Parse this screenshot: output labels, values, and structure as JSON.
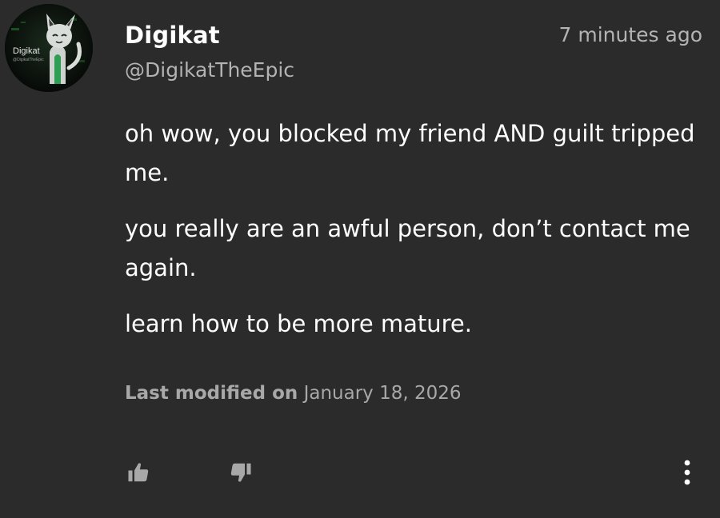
{
  "comment": {
    "author": {
      "display_name": "Digikat",
      "handle": "@DigikatTheEpic",
      "avatar_caption": "Digikat",
      "avatar_subcaption": "@DigikatTheEpic"
    },
    "timestamp": "7 minutes ago",
    "paragraphs": [
      "oh wow, you blocked my friend AND guilt tripped me.",
      "you really are an awful person, don’t contact me again.",
      "learn how to be more mature."
    ],
    "modified_label": "Last modified on",
    "modified_date": "January 18, 2026"
  },
  "actions": {
    "like_icon": "thumbs-up-icon",
    "dislike_icon": "thumbs-down-icon",
    "more_icon": "more-vertical-icon"
  },
  "colors": {
    "background": "#2b2b2b",
    "text_primary": "#ffffff",
    "text_secondary": "#b3b3b3",
    "icon": "#a8a8a8"
  }
}
